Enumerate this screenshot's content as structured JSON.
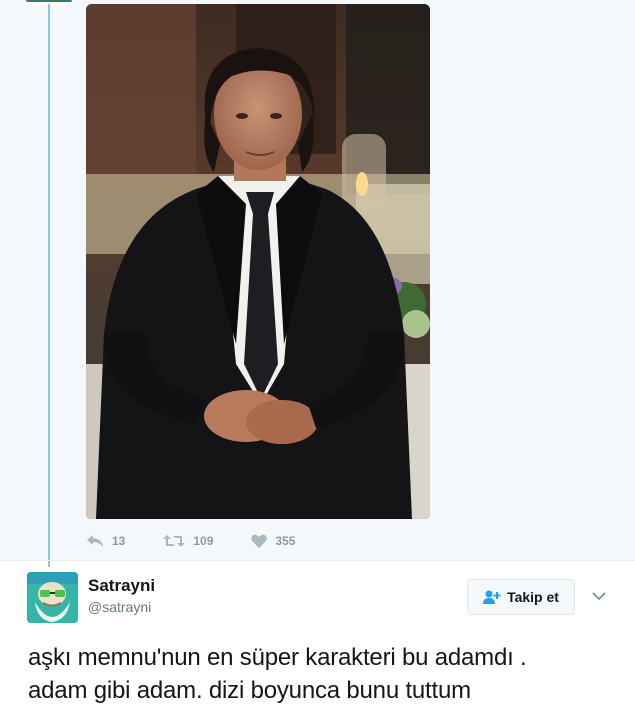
{
  "tweet1": {
    "stats": {
      "replies": "13",
      "retweets": "109",
      "likes": "355"
    }
  },
  "tweet2": {
    "display_name": "Satrayni",
    "handle": "@satrayni",
    "follow_label": "Takip et",
    "text_line1": "aşkı memnu'nun en süper karakteri bu adamdı .",
    "text_line2": "adam gibi adam. dizi boyunca bunu tuttum"
  },
  "colors": {
    "accent_blue": "#1da1f2",
    "thread_line": "#8fc4ec",
    "muted": "#8899a6"
  },
  "icons": [
    "reply-icon",
    "retweet-icon",
    "heart-icon",
    "add-user-icon",
    "chevron-down-icon"
  ]
}
